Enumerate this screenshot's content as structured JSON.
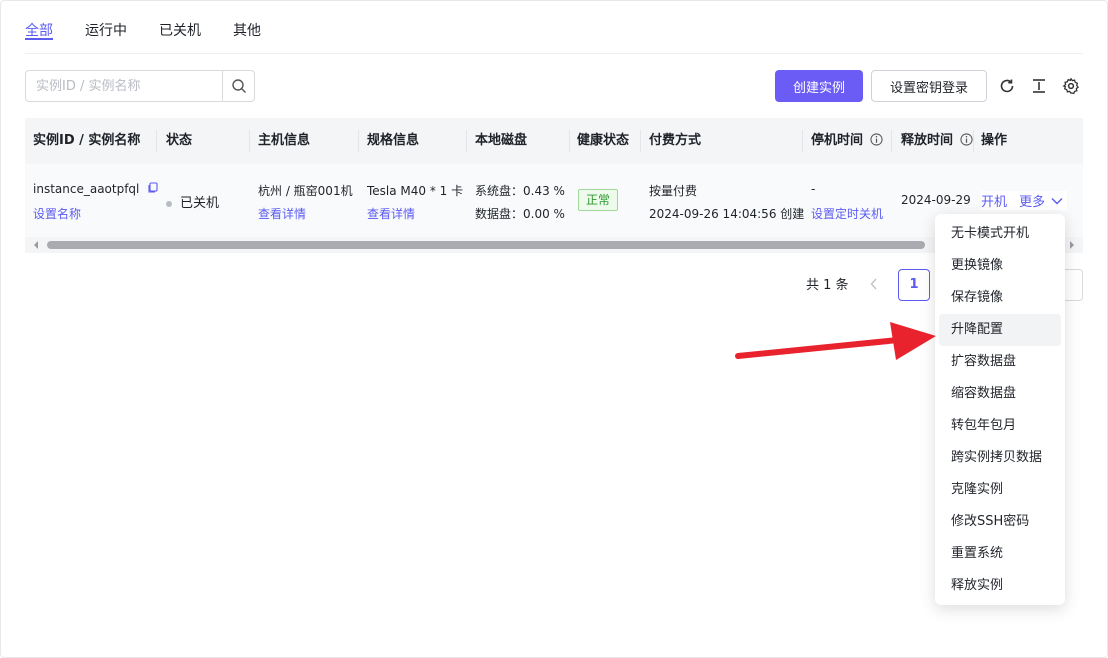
{
  "tabs": [
    {
      "label": "全部",
      "active": true
    },
    {
      "label": "运行中",
      "active": false
    },
    {
      "label": "已关机",
      "active": false
    },
    {
      "label": "其他",
      "active": false
    }
  ],
  "search": {
    "placeholder": "实例ID / 实例名称"
  },
  "toolbar": {
    "create_label": "创建实例",
    "ssh_key_label": "设置密钥登录",
    "icons": [
      "refresh-icon",
      "column-height-icon",
      "settings-icon"
    ]
  },
  "table": {
    "headers": [
      "实例ID / 实例名称",
      "状态",
      "主机信息",
      "规格信息",
      "本地磁盘",
      "健康状态",
      "付费方式",
      "停机时间",
      "释放时间",
      "操作"
    ],
    "row": {
      "instance_id": "instance_aaotpfql",
      "set_name": "设置名称",
      "status": "已关机",
      "host": "杭州 / 瓶窑001机",
      "host_detail": "查看详情",
      "spec": "Tesla M40 * 1 卡",
      "spec_detail": "查看详情",
      "disk_system": "系统盘：0.43 %",
      "disk_data": "数据盘：0.00 %",
      "health": "正常",
      "billing": "按量付费",
      "created": "2024-09-26 14:04:56 创建",
      "stop_time": "-",
      "stop_action": "设置定时关机",
      "release_time": "2024-09-29",
      "op_start": "开机",
      "op_more": "更多"
    }
  },
  "pagination": {
    "total": "共 1 条",
    "current": "1"
  },
  "dropdown": {
    "items": [
      "无卡模式开机",
      "更换镜像",
      "保存镜像",
      "升降配置",
      "扩容数据盘",
      "缩容数据盘",
      "转包年包月",
      "跨实例拷贝数据",
      "克隆实例",
      "修改SSH密码",
      "重置系统",
      "释放实例"
    ],
    "highlighted": "升降配置"
  },
  "colors": {
    "accent": "#5b5bf2",
    "primary_button": "#6b5cf6",
    "annotation": "#e8232e",
    "health_green": "#2e9a2e"
  }
}
